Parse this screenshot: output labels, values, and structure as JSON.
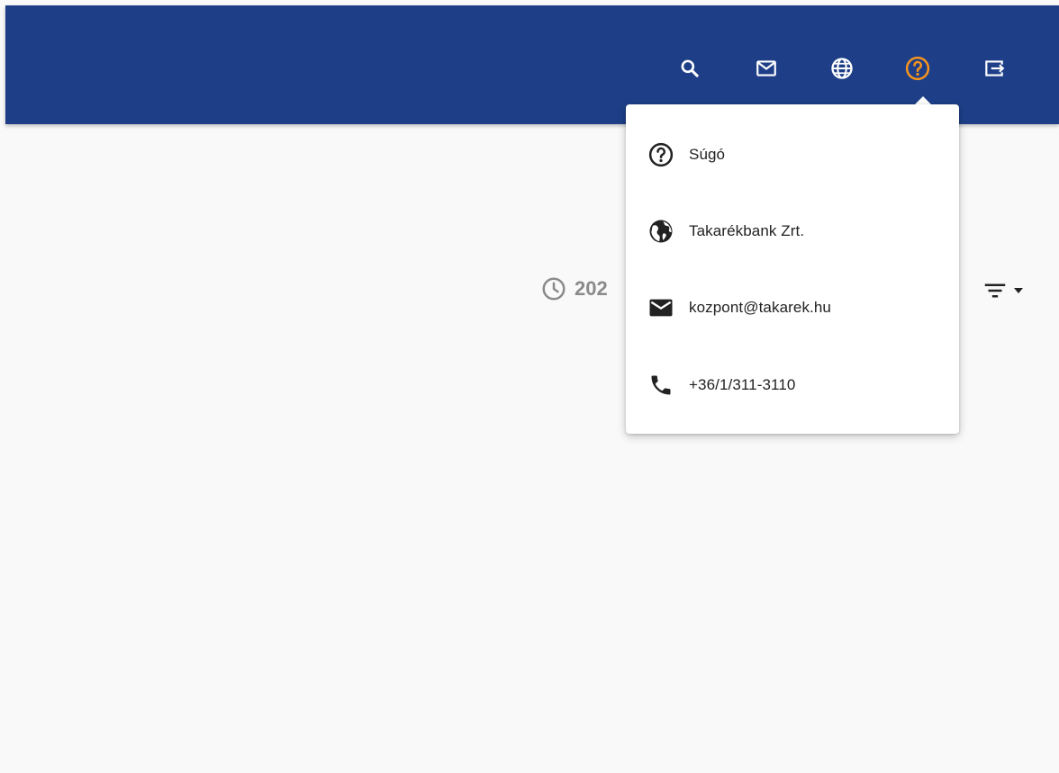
{
  "topbar": {
    "bg_color": "#1e3f88",
    "icons": [
      {
        "name": "search-icon"
      },
      {
        "name": "mail-icon"
      },
      {
        "name": "globe-icon"
      },
      {
        "name": "help-icon",
        "active_color": "#f7941d"
      },
      {
        "name": "logout-icon"
      }
    ]
  },
  "content": {
    "timestamp_partial": "202",
    "clock_icon": "clock-icon",
    "filter_icon": "filter-icon"
  },
  "help_menu": {
    "items": [
      {
        "icon": "help-icon",
        "label": "Súgó"
      },
      {
        "icon": "globe-icon",
        "label": "Takarékbank Zrt."
      },
      {
        "icon": "mail-icon",
        "label": "kozpont@takarek.hu"
      },
      {
        "icon": "phone-icon",
        "label": "+36/1/311-3110"
      }
    ]
  }
}
